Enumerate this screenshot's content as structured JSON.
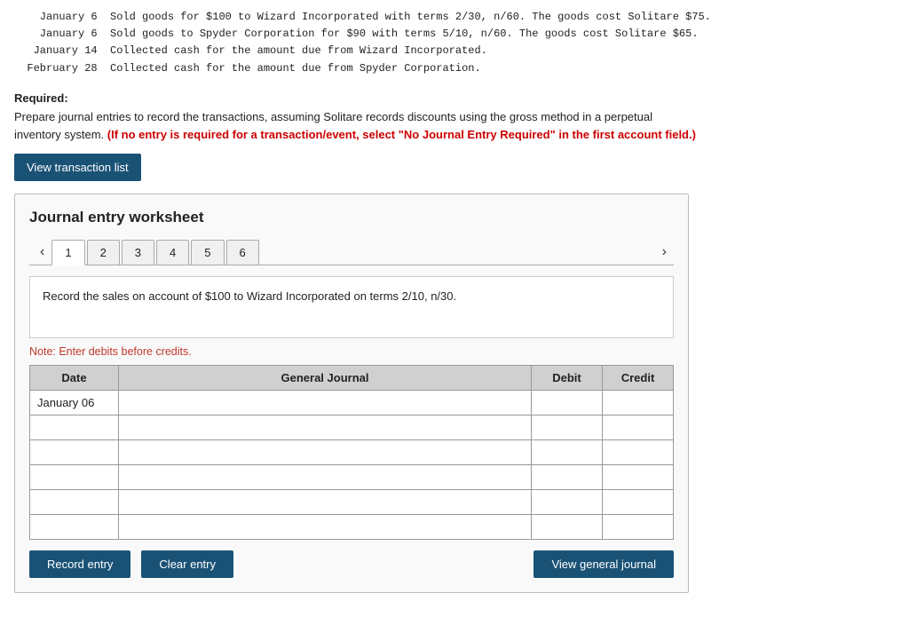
{
  "intro": {
    "line1": "    January 6  Sold goods for $100 to Wizard Incorporated with terms 2/30, n/60. The goods cost Solitare $75.",
    "line2": "    January 6  Sold goods to Spyder Corporation for $90 with terms 5/10, n/60. The goods cost Solitare $65.",
    "line3": "   January 14  Collected cash for the amount due from Wizard Incorporated.",
    "line4": "  February 28  Collected cash for the amount due from Spyder Corporation."
  },
  "required": {
    "label": "Required:",
    "text": "Prepare journal entries to record the transactions, assuming Solitare records discounts using the gross method in a perpetual",
    "text2": "inventory system. ",
    "red_text": "(If no entry is required for a transaction/event, select \"No Journal Entry Required\" in the first account field.)"
  },
  "buttons": {
    "view_transaction": "View transaction list",
    "record_entry": "Record entry",
    "clear_entry": "Clear entry",
    "view_general_journal": "View general journal"
  },
  "worksheet": {
    "title": "Journal entry worksheet",
    "tabs": [
      {
        "label": "1",
        "active": true
      },
      {
        "label": "2",
        "active": false
      },
      {
        "label": "3",
        "active": false
      },
      {
        "label": "4",
        "active": false
      },
      {
        "label": "5",
        "active": false
      },
      {
        "label": "6",
        "active": false
      }
    ],
    "task_description": "Record the sales on account of $100 to Wizard Incorporated on terms 2/10,\nn/30.",
    "note": "Note: Enter debits before credits.",
    "table": {
      "headers": {
        "date": "Date",
        "general_journal": "General Journal",
        "debit": "Debit",
        "credit": "Credit"
      },
      "rows": [
        {
          "date": "January 06",
          "journal": "",
          "debit": "",
          "credit": ""
        },
        {
          "date": "",
          "journal": "",
          "debit": "",
          "credit": ""
        },
        {
          "date": "",
          "journal": "",
          "debit": "",
          "credit": ""
        },
        {
          "date": "",
          "journal": "",
          "debit": "",
          "credit": ""
        },
        {
          "date": "",
          "journal": "",
          "debit": "",
          "credit": ""
        },
        {
          "date": "",
          "journal": "",
          "debit": "",
          "credit": ""
        }
      ]
    }
  }
}
